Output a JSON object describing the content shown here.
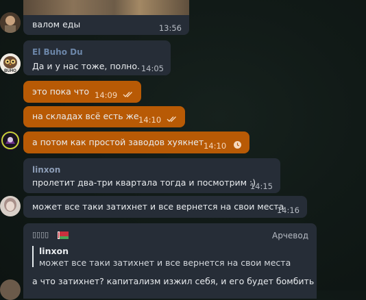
{
  "messages": [
    {
      "id": "m1",
      "text": "валом еды",
      "time": "13:56",
      "direction": "in"
    },
    {
      "id": "m2",
      "sender": "El Buho Du",
      "text": "Да и у нас тоже, полно.",
      "time": "14:05",
      "direction": "in",
      "avatar_label": "BUHO"
    },
    {
      "id": "m3",
      "text": "это пока что",
      "time": "14:09",
      "direction": "out",
      "status": "read"
    },
    {
      "id": "m4",
      "text": "на складах всё есть же",
      "time": "14:10",
      "direction": "out",
      "status": "read"
    },
    {
      "id": "m5",
      "text": "а потом как простой заводов хуякнет",
      "time": "14:10",
      "direction": "out",
      "status": "sending"
    },
    {
      "id": "m6",
      "sender": "linxon",
      "text": "пролетит два-три квартала тогда и посмотрим :)",
      "time": "14:15",
      "direction": "in"
    },
    {
      "id": "m7",
      "text": "может все таки затихнет и все вернется на свои места",
      "time": "14:16",
      "direction": "in"
    },
    {
      "id": "m8",
      "sender": "▯▯▯▯",
      "sender_flag": "🇧🇾",
      "admin_title": "Арчевод",
      "reply_to": {
        "sender": "linxon",
        "text": "может все таки затихнет и все вернется на свои места"
      },
      "text": "а что затихнет? капитализм изжил себя, и его будет бомбить",
      "direction": "in"
    }
  ],
  "colors": {
    "incoming_bubble": "#262d37",
    "outgoing_bubble": "#b85a05",
    "sender_name": "#6c86a8",
    "linxon_name": "#8c9cb5",
    "background": "#111a17"
  },
  "icons": {
    "read": "double-check-icon",
    "sending": "clock-icon",
    "flag": "belarus-flag-icon"
  }
}
